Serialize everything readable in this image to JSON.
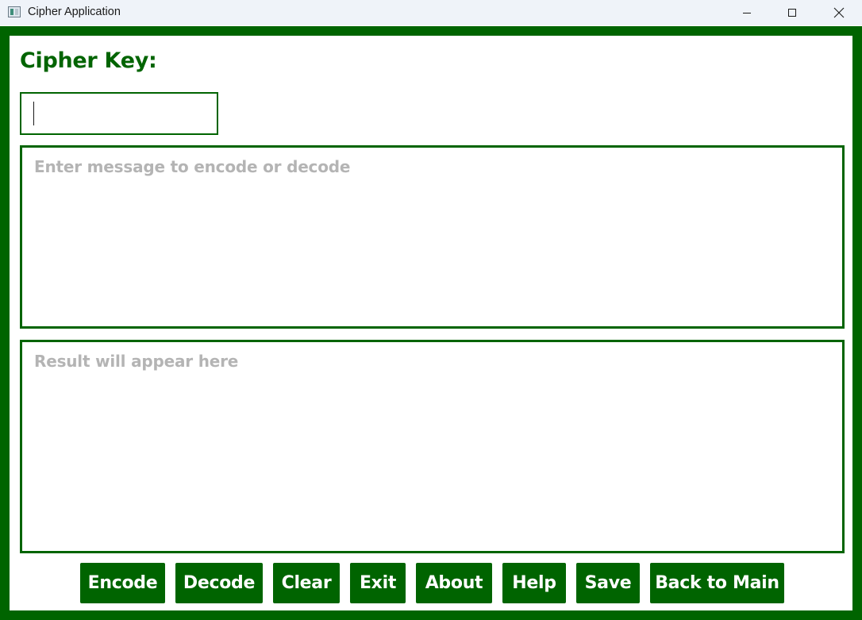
{
  "window": {
    "title": "Cipher Application",
    "controls": [
      "minimize-icon",
      "maximize-icon",
      "close-icon"
    ]
  },
  "theme": {
    "accent": "#006400",
    "background": "#ffffff",
    "placeholder": "#b4b4b4",
    "button_text": "#ffffff"
  },
  "form": {
    "key_label": "Cipher Key:",
    "key_value": "",
    "message_placeholder": "Enter message to encode or decode",
    "message_value": "",
    "result_placeholder": "Result will appear here",
    "result_value": ""
  },
  "buttons": {
    "encode": "Encode",
    "decode": "Decode",
    "clear": "Clear",
    "exit": "Exit",
    "about": "About",
    "help": "Help",
    "save": "Save",
    "back": "Back to Main"
  }
}
